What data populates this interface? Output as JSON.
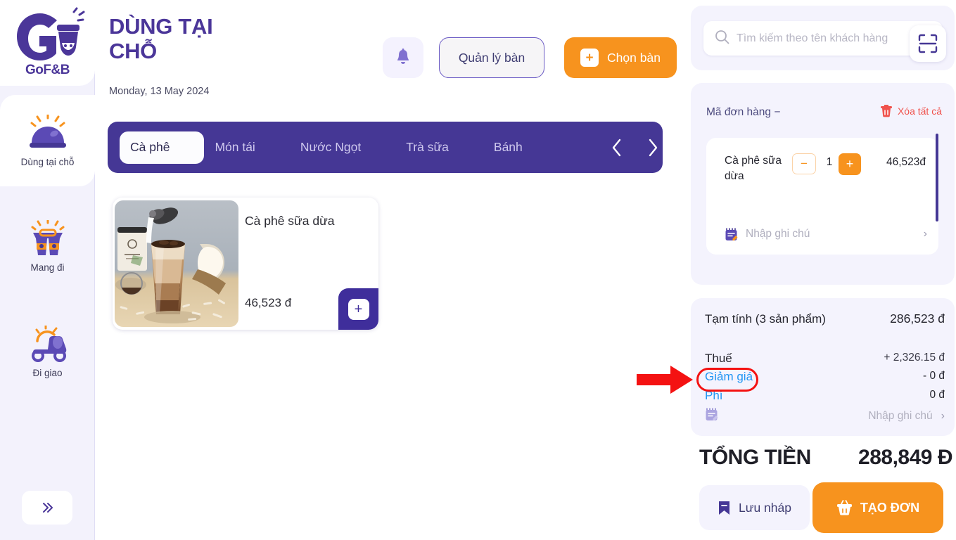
{
  "brand": {
    "logo_text": "GoF&B",
    "logo_icon": "gofnb-logo-icon"
  },
  "sidebar": {
    "items": [
      {
        "label": "Dùng tại chỗ",
        "icon": "dine-in-cloche-icon",
        "active": true
      },
      {
        "label": "Mang đi",
        "icon": "takeaway-cups-icon",
        "active": false
      },
      {
        "label": "Đi giao",
        "icon": "delivery-scooter-icon",
        "active": false
      }
    ],
    "collapse_icon": "double-chevron-right-icon"
  },
  "header": {
    "title": "DÙNG TẠI CHỖ",
    "date": "Monday, 13 May 2024",
    "bell_icon": "bell-icon",
    "manage_tables_label": "Quản lý bàn",
    "pick_table_label": "Chọn bàn",
    "pick_table_icon": "plus-square-icon"
  },
  "tabs": {
    "items": [
      {
        "label": "Cà phê",
        "active": true
      },
      {
        "label": "Món tái",
        "active": false
      },
      {
        "label": "Nước Ngọt",
        "active": false
      },
      {
        "label": "Trà sữa",
        "active": false
      },
      {
        "label": "Bánh",
        "active": false
      }
    ],
    "prev_icon": "chevron-left-icon",
    "next_icon": "chevron-right-icon"
  },
  "products": [
    {
      "name": "Cà phê sữa dừa",
      "price": "46,523 đ",
      "image_alt": "iced-coconut-milk-coffee-photo",
      "add_icon": "plus-icon"
    }
  ],
  "search": {
    "placeholder": "Tìm kiếm theo tên khách hàng",
    "value": "",
    "search_icon": "search-icon",
    "scan_icon": "barcode-scan-icon"
  },
  "order": {
    "code_label": "Mã đơn hàng  −",
    "clear_all_label": "Xóa tất cả",
    "clear_all_icon": "trash-icon",
    "items": [
      {
        "name": "Cà phê sữa dừa",
        "qty": "1",
        "price": "46,523đ",
        "minus_icon": "minus-icon",
        "plus_icon": "plus-icon"
      }
    ],
    "note_placeholder": "Nhập ghi chú",
    "note_icon": "note-icon",
    "note_chevron": "chevron-right-icon"
  },
  "summary": {
    "subtotal_label": "Tạm tính  (3 sản phẩm)",
    "subtotal_value": "286,523 đ",
    "tax_label": "Thuế",
    "tax_value": "+ 2,326.15 đ",
    "discount_label": "Giảm giá",
    "discount_value": "- 0 đ",
    "fee_label": "Phí",
    "fee_value": "0 đ",
    "note_icon": "note-icon",
    "note_placeholder": "Nhập ghi chú",
    "note_chevron": "chevron-right-icon",
    "grand_total_label": "TỔNG TIỀN",
    "grand_total_value": "288,849 Đ"
  },
  "footer": {
    "draft_label": "Lưu nháp",
    "draft_icon": "bookmark-icon",
    "create_label": "TẠO ĐƠN",
    "create_icon": "basket-icon"
  },
  "annotation": {
    "arrow_color": "#f41212",
    "highlight_target": "Giảm giá"
  },
  "colors": {
    "brand_purple": "#453795",
    "accent_orange": "#f7931e",
    "panel_lilac": "#f4f3fd",
    "link_blue": "#2196f3",
    "danger_red": "#f0524d"
  }
}
